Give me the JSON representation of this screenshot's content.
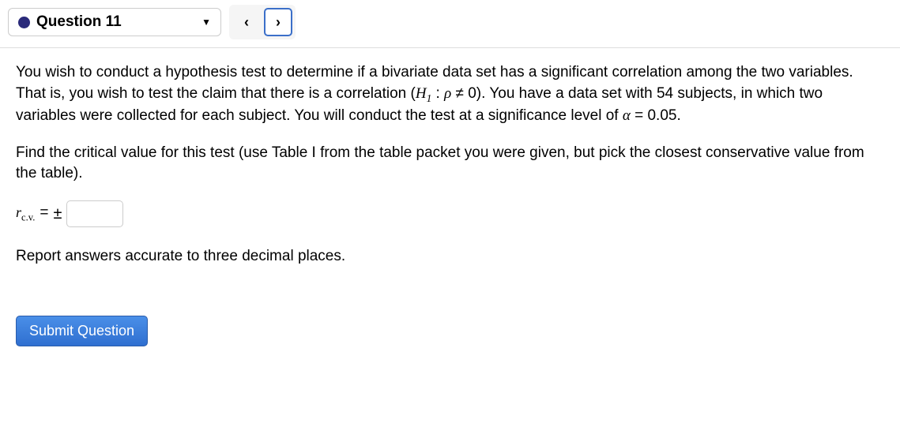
{
  "header": {
    "question_label": "Question 11",
    "prev_symbol": "‹",
    "next_symbol": "›"
  },
  "content": {
    "para1_a": "You wish to conduct a hypothesis test to determine if a bivariate data set has a significant correlation among the two variables. That is, you wish to test the claim that there is a correlation (",
    "h1_text": "H",
    "h1_sub": "1",
    "colon": " : ",
    "rho": "ρ",
    "neq": " ≠ ",
    "zero": "0",
    "para1_b": "). You have a data set with 54 subjects, in which two variables were collected for each subject. You will conduct the test at a significance level of ",
    "alpha": "α",
    "eq": " = ",
    "alpha_val": "0.05",
    "period": ".",
    "para2": "Find the critical value for this test (use Table I from the table packet you were given, but pick the closest conservative value from the table).",
    "cv_r": "r",
    "cv_sub": "c.v.",
    "cv_eq": " = ",
    "pm": "±",
    "para3": "Report answers accurate to three decimal places.",
    "submit_label": "Submit Question"
  }
}
